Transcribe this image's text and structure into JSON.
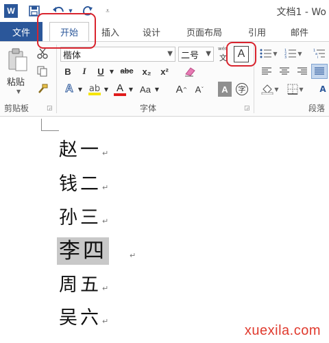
{
  "title_bar": {
    "app_icon": "W",
    "qat_icons": [
      "word-app-icon",
      "save-icon",
      "undo-icon",
      "redo-icon",
      "customize-qat-icon"
    ],
    "document_title": "文档1 - Wo"
  },
  "tabs": {
    "file": "文件",
    "items": [
      "开始",
      "插入",
      "设计",
      "页面布局",
      "引用",
      "邮件"
    ],
    "active": "开始"
  },
  "clipboard": {
    "paste_label": "粘贴",
    "group_label": "剪贴板",
    "icons": [
      "paste-icon",
      "cut-icon",
      "copy-icon",
      "format-painter-icon"
    ]
  },
  "font": {
    "font_name": "楷体",
    "font_size": "二号",
    "wen_label": "wén",
    "char_border_symbol": "A",
    "bold": "B",
    "italic": "I",
    "underline": "U",
    "strikethrough": "abc",
    "subscript": "x₂",
    "superscript": "x²",
    "text_effects": "A",
    "font_color": "A",
    "change_case": "Aa",
    "grow_font": "A",
    "shrink_font": "A",
    "char_shading": "A",
    "enclose_char": "字",
    "group_label": "字体",
    "highlight_color": "#f5e50a",
    "font_color_bar": "#e01c1c"
  },
  "paragraph": {
    "group_label": "段落",
    "icons": [
      "bullets-icon",
      "numbering-icon",
      "multilevel-list-icon",
      "align-left-icon",
      "center-icon",
      "align-right-icon",
      "justify-icon",
      "shading-icon",
      "borders-icon"
    ]
  },
  "document": {
    "lines": [
      {
        "text": "赵一",
        "selected": false
      },
      {
        "text": "钱二",
        "selected": false
      },
      {
        "text": "孙三",
        "selected": false
      },
      {
        "text": "李四",
        "selected": true
      },
      {
        "text": "周五",
        "selected": false
      },
      {
        "text": "吴六",
        "selected": false
      }
    ],
    "paragraph_mark": "↵"
  },
  "watermark": "xuexila.com",
  "colors": {
    "accent": "#2b579a",
    "callout": "#d9232d",
    "selection": "#c8c8c8"
  }
}
